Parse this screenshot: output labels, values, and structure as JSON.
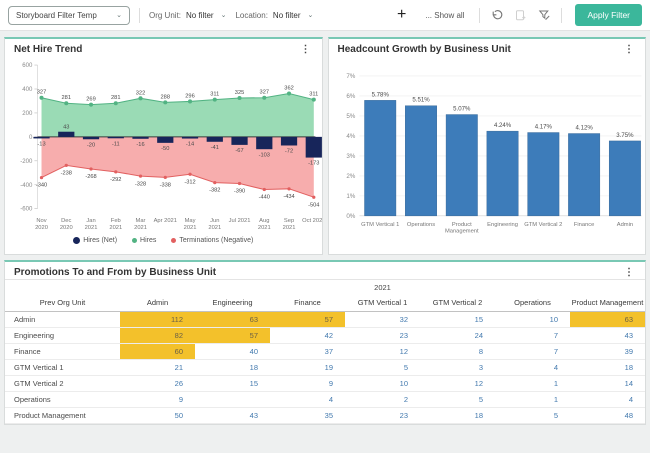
{
  "toolbar": {
    "storyboard_dropdown": "Storyboard Filter Temp",
    "org_unit_label": "Org Unit:",
    "org_unit_value": "No filter",
    "location_label": "Location:",
    "location_value": "No filter",
    "show_all": "... Show all",
    "apply_filter": "Apply Filter"
  },
  "colors": {
    "accent_teal": "#3bb79b",
    "card_top_border": "#79c8b4",
    "navy": "#17255a",
    "green_fill": "#9adbb5",
    "green_line": "#52b383",
    "red_fill": "#f7adad",
    "red_line": "#e26060",
    "bar_blue": "#3d7cba",
    "highlight_yellow": "#f3c12b",
    "table_number_blue": "#4279ae"
  },
  "chart_data": [
    {
      "type": "area",
      "title": "Net Hire Trend",
      "x_labels": [
        [
          "Nov",
          "2020"
        ],
        [
          "Dec",
          "2020"
        ],
        [
          "Jan",
          "2021"
        ],
        [
          "Feb",
          "2021"
        ],
        [
          "Mar",
          "2021"
        ],
        [
          "Apr 2021"
        ],
        [
          "May",
          "2021"
        ],
        [
          "Jun",
          "2021"
        ],
        [
          "Jul 2021"
        ],
        [
          "Aug",
          "2021"
        ],
        [
          "Sep",
          "2021"
        ],
        [
          "Oct 2021"
        ]
      ],
      "y_ticks": [
        600,
        400,
        200,
        0,
        -200,
        -400,
        -600
      ],
      "ylim": [
        -600,
        600
      ],
      "series": {
        "hires": {
          "name": "Hires",
          "values": [
            327,
            281,
            269,
            281,
            322,
            288,
            296,
            311,
            325,
            327,
            362,
            311
          ]
        },
        "net": {
          "name": "Hires (Net)",
          "values": [
            -13,
            43,
            -20,
            -11,
            -16,
            -50,
            -14,
            -41,
            -67,
            -103,
            -72,
            -173
          ]
        },
        "terminations": {
          "name": "Terminations (Negative)",
          "values": [
            -340,
            -238,
            -268,
            -292,
            -328,
            -338,
            -312,
            -382,
            -390,
            -440,
            -434,
            -504
          ]
        }
      },
      "legend": [
        "Hires (Net)",
        "Hires",
        "Terminations (Negative)"
      ],
      "colors": {
        "hires_fill": "#9adbb5",
        "hires_line": "#52b383",
        "term_fill": "#f7adad",
        "term_line": "#e26060",
        "net_bar": "#17255a"
      }
    },
    {
      "type": "bar",
      "title": "Headcount Growth by Business Unit",
      "categories": [
        [
          "GTM Vertical 1"
        ],
        [
          "Operations"
        ],
        [
          "Product",
          "Management"
        ],
        [
          "Engineering"
        ],
        [
          "GTM Vertical 2"
        ],
        [
          "Finance"
        ],
        [
          "Admin"
        ]
      ],
      "values": [
        5.78,
        5.51,
        5.07,
        4.24,
        4.17,
        4.12,
        3.75
      ],
      "labels": [
        "5.78%",
        "5.51%",
        "5.07%",
        "4.24%",
        "4.17%",
        "4.12%",
        "3.75%"
      ],
      "ylim": [
        0,
        7
      ],
      "y_tick_suffix": "%",
      "bar_color": "#3d7cba"
    },
    {
      "type": "table",
      "title": "Promotions To and From by Business Unit",
      "year": "2021",
      "prev_col": "Prev Org Unit",
      "columns": [
        "Admin",
        "Engineering",
        "Finance",
        "GTM Vertical 1",
        "GTM Vertical 2",
        "Operations",
        "Product Management"
      ],
      "rows": [
        {
          "label": "Admin",
          "values": [
            "112",
            "63",
            "57",
            "32",
            "15",
            "10",
            "63"
          ],
          "highlight": [
            true,
            true,
            true,
            false,
            false,
            false,
            true
          ]
        },
        {
          "label": "Engineering",
          "values": [
            "82",
            "57",
            "42",
            "23",
            "24",
            "7",
            "43"
          ],
          "highlight": [
            true,
            true,
            false,
            false,
            false,
            false,
            false
          ]
        },
        {
          "label": "Finance",
          "values": [
            "60",
            "40",
            "37",
            "12",
            "8",
            "7",
            "39"
          ],
          "highlight": [
            true,
            false,
            false,
            false,
            false,
            false,
            false
          ]
        },
        {
          "label": "GTM Vertical 1",
          "values": [
            "21",
            "18",
            "19",
            "5",
            "3",
            "4",
            "18"
          ],
          "highlight": [
            false,
            false,
            false,
            false,
            false,
            false,
            false
          ]
        },
        {
          "label": "GTM Vertical 2",
          "values": [
            "26",
            "15",
            "9",
            "10",
            "12",
            "1",
            "14"
          ],
          "highlight": [
            false,
            false,
            false,
            false,
            false,
            false,
            false
          ]
        },
        {
          "label": "Operations",
          "values": [
            "9",
            "",
            "4",
            "2",
            "5",
            "1",
            "4"
          ],
          "highlight": [
            false,
            false,
            false,
            false,
            false,
            false,
            false
          ]
        },
        {
          "label": "Product Management",
          "values": [
            "50",
            "43",
            "35",
            "23",
            "18",
            "5",
            "48"
          ],
          "highlight": [
            false,
            false,
            false,
            false,
            false,
            false,
            false
          ]
        }
      ]
    }
  ]
}
